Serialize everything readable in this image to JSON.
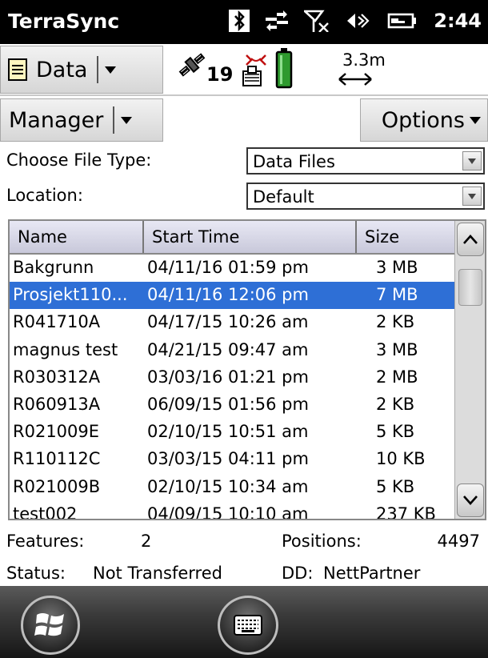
{
  "titlebar": {
    "app_name": "TerraSync",
    "time": "2:44",
    "status_icons": [
      "bluetooth-icon",
      "network-sync-icon",
      "signal-off-icon",
      "volume-icon",
      "battery-charging-icon"
    ]
  },
  "toolbar": {
    "section_label": "Data",
    "satellite_count": "19",
    "distance_value": "3.3m",
    "distance_icon": "left-right-arrow-icon"
  },
  "toolbar2": {
    "menu_label": "Manager",
    "options_label": "Options"
  },
  "form": {
    "file_type_label": "Choose File Type:",
    "file_type_value": "Data Files",
    "location_label": "Location:",
    "location_value": "Default"
  },
  "table": {
    "columns": [
      "Name",
      "Start Time",
      "Size"
    ],
    "rows": [
      {
        "name": "Bakgrunn",
        "start": "04/11/16 01:59 pm",
        "size": "3 MB"
      },
      {
        "name": "Prosjekt110...",
        "start": "04/11/16 12:06 pm",
        "size": "7 MB"
      },
      {
        "name": "R041710A",
        "start": "04/17/15 10:26 am",
        "size": "2 KB"
      },
      {
        "name": "magnus test",
        "start": "04/21/15 09:47 am",
        "size": "3 MB"
      },
      {
        "name": "R030312A",
        "start": "03/03/16 01:21 pm",
        "size": "2 MB"
      },
      {
        "name": "R060913A",
        "start": "06/09/15 01:56 pm",
        "size": "2 KB"
      },
      {
        "name": "R021009E",
        "start": "02/10/15 10:51 am",
        "size": "5 KB"
      },
      {
        "name": "R110112C",
        "start": "03/03/15 04:11 pm",
        "size": "10 KB"
      },
      {
        "name": "R021009B",
        "start": "02/10/15 10:34 am",
        "size": "5 KB"
      },
      {
        "name": "test002",
        "start": "04/09/15 10:10 am",
        "size": "237 KB"
      }
    ],
    "selected_row": 1
  },
  "info": {
    "features_label": "Features:",
    "features_value": "2",
    "positions_label": "Positions:",
    "positions_value": "4497",
    "status_label": "Status:",
    "status_value": "Not Transferred",
    "dd_label": "DD:",
    "dd_value": "NettPartner"
  },
  "colors": {
    "titlebar": "#000000",
    "selection": "#2e6fd6",
    "header_gradient": "#c8c8da",
    "battery": "#2e9a2e"
  }
}
